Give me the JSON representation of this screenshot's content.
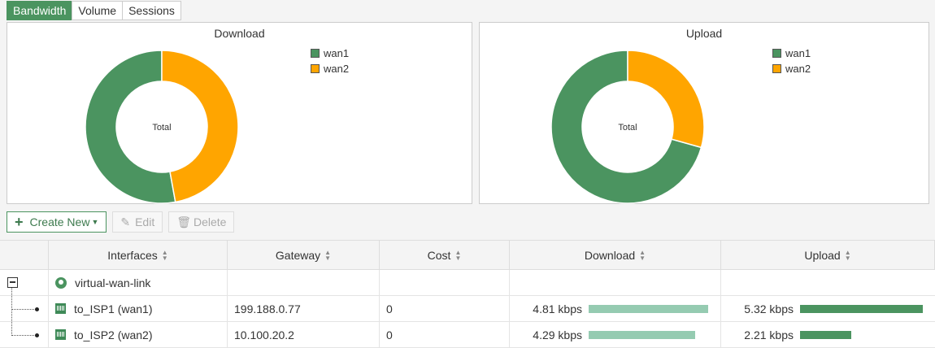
{
  "tabs": [
    {
      "label": "Bandwidth",
      "active": true
    },
    {
      "label": "Volume",
      "active": false
    },
    {
      "label": "Sessions",
      "active": false
    }
  ],
  "chart_data": [
    {
      "type": "pie",
      "title": "Download",
      "center_label": "Total",
      "categories": [
        "wan1",
        "wan2"
      ],
      "values": [
        4.81,
        4.29
      ],
      "colors": [
        "#4b9460",
        "#ffa500"
      ],
      "legend": "top-right"
    },
    {
      "type": "pie",
      "title": "Upload",
      "center_label": "Total",
      "categories": [
        "wan1",
        "wan2"
      ],
      "values": [
        5.32,
        2.21
      ],
      "colors": [
        "#4b9460",
        "#ffa500"
      ],
      "legend": "top-right"
    }
  ],
  "toolbar": {
    "create_new": "Create New",
    "edit": "Edit",
    "delete": "Delete"
  },
  "table": {
    "columns": [
      "Interfaces",
      "Gateway",
      "Cost",
      "Download",
      "Upload"
    ],
    "group": {
      "name": "virtual-wan-link"
    },
    "rows": [
      {
        "interface": "to_ISP1 (wan1)",
        "gateway": "199.188.0.77",
        "cost": "0",
        "download": "4.81 kbps",
        "download_fraction": 1.0,
        "upload": "5.32 kbps",
        "upload_fraction": 1.0
      },
      {
        "interface": "to_ISP2 (wan2)",
        "gateway": "10.100.20.2",
        "cost": "0",
        "download": "4.29 kbps",
        "download_fraction": 0.89,
        "upload": "2.21 kbps",
        "upload_fraction": 0.42
      }
    ]
  },
  "colors": {
    "accent": "#4b9460",
    "wan2": "#ffa500",
    "bar_light": "#95cbb1",
    "bar_dark": "#4b9460"
  }
}
